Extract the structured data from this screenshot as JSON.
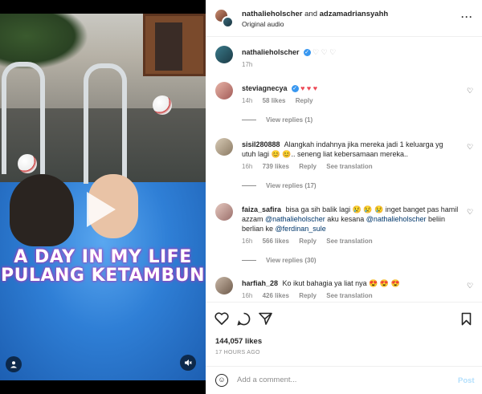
{
  "header": {
    "user1": "nathalieholscher",
    "joiner": "and",
    "user2": "adzamadriansyahh",
    "audio": "Original audio",
    "more_icon": "more-horizontal-icon"
  },
  "video": {
    "caption_line1": "A DAY IN MY LIFE",
    "caption_line2": "PULANG KETAMBUN",
    "play_icon": "play-icon",
    "avatar_icon": "user-icon",
    "volume_icon": "speaker-muted-icon"
  },
  "post_caption": {
    "user": "nathalieholscher",
    "text": "♡ ♡ ♡",
    "time": "17h"
  },
  "comments": [
    {
      "user": "steviagnecya",
      "text_parts": [
        "♥ ♥ ♥"
      ],
      "time": "14h",
      "likes": "58 likes",
      "reply": "Reply",
      "translate": "",
      "view_replies": "View replies (1)"
    },
    {
      "user": "sisil280888",
      "text": "Alangkah indahnya jika mereka jadi 1 keluarga yg utuh lagi 😊 😊.. seneng liat kebersamaan mereka..",
      "time": "16h",
      "likes": "739 likes",
      "reply": "Reply",
      "translate": "See translation",
      "view_replies": "View replies (17)"
    },
    {
      "user": "faiza_safira",
      "text_a": "bisa ga sih balik lagi 😢 😢 😢 inget banget pas hamil azzam",
      "mention1": "@nathalieholscher",
      "text_b": "aku kesana",
      "mention2": "@nathalieholscher",
      "text_c": "beliin berlian ke",
      "mention3": "@ferdinan_sule",
      "time": "16h",
      "likes": "566 likes",
      "reply": "Reply",
      "translate": "See translation",
      "view_replies": "View replies (30)"
    },
    {
      "user": "harfiah_28",
      "text": "Ko ikut bahagia ya liat nya 😍 😍 😍",
      "time": "16h",
      "likes": "426 likes",
      "reply": "Reply",
      "translate": "See translation"
    }
  ],
  "actions": {
    "like_icon": "heart-icon",
    "comment_icon": "comment-icon",
    "share_icon": "send-icon",
    "save_icon": "bookmark-icon",
    "likes": "144,057 likes",
    "date": "17 HOURS AGO"
  },
  "add_comment": {
    "placeholder": "Add a comment...",
    "post_label": "Post",
    "emoji_icon": "smile-icon"
  },
  "colors": {
    "accent": "#0095f6",
    "post_disabled": "#b2dffc",
    "verified": "#3897f0",
    "like_red": "#ed4956"
  }
}
